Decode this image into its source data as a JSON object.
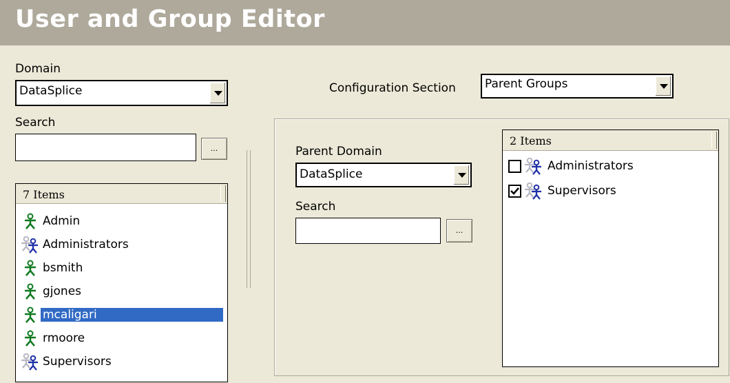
{
  "title": "User and Group Editor",
  "left": {
    "domain_label": "Domain",
    "domain_value": "DataSplice",
    "search_label": "Search",
    "search_value": "",
    "browse_label": "...",
    "list_header": "7 Items",
    "items": [
      {
        "label": "Admin",
        "icon": "user-icon"
      },
      {
        "label": "Administrators",
        "icon": "group-icon"
      },
      {
        "label": "bsmith",
        "icon": "user-icon"
      },
      {
        "label": "gjones",
        "icon": "user-icon"
      },
      {
        "label": "mcaligari",
        "icon": "user-icon",
        "selected": true
      },
      {
        "label": "rmoore",
        "icon": "user-icon"
      },
      {
        "label": "Supervisors",
        "icon": "group-icon"
      }
    ]
  },
  "config": {
    "section_label": "Configuration Section",
    "section_value": "Parent Groups"
  },
  "right": {
    "parent_domain_label": "Parent Domain",
    "parent_domain_value": "DataSplice",
    "search_label": "Search",
    "search_value": "",
    "browse_label": "...",
    "list_header": "2 Items",
    "items": [
      {
        "label": "Administrators",
        "icon": "group-icon",
        "checked": false
      },
      {
        "label": "Supervisors",
        "icon": "group-icon",
        "checked": true
      }
    ]
  },
  "colors": {
    "title_bar": "#aea99b",
    "background": "#ece9d8",
    "selection": "#316ac5",
    "user_icon": "#0f7a1f",
    "group_icon": "#1f2fa8"
  }
}
